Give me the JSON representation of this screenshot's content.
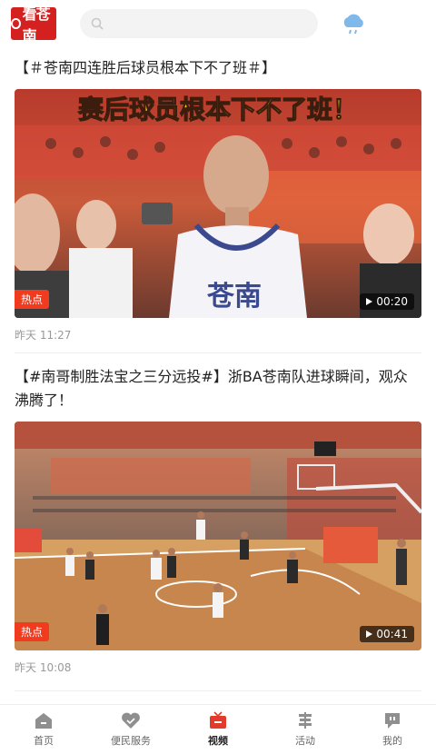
{
  "header": {
    "logo_text": "看苍南",
    "search_placeholder": "",
    "weather_icon": "cloud-rain-icon"
  },
  "feed": [
    {
      "title": "【＃苍南四连胜后球员根本下不了班＃】",
      "thumbnail_caption": "赛后球员根本下不了班！",
      "badge": "热点",
      "duration": "00:20",
      "time": "昨天 11:27"
    },
    {
      "title": "【#南哥制胜法宝之三分远投#】浙BA苍南队进球瞬间，观众沸腾了！",
      "badge": "热点",
      "duration": "00:41",
      "time": "昨天 10:08"
    }
  ],
  "nav": {
    "items": [
      {
        "label": "首页",
        "icon": "home-icon"
      },
      {
        "label": "便民服务",
        "icon": "heart-icon"
      },
      {
        "label": "视频",
        "icon": "tv-icon"
      },
      {
        "label": "活动",
        "icon": "flag-icon"
      },
      {
        "label": "我的",
        "icon": "chat-icon"
      }
    ],
    "active_index": 2,
    "accent_color": "#e33b2b"
  }
}
